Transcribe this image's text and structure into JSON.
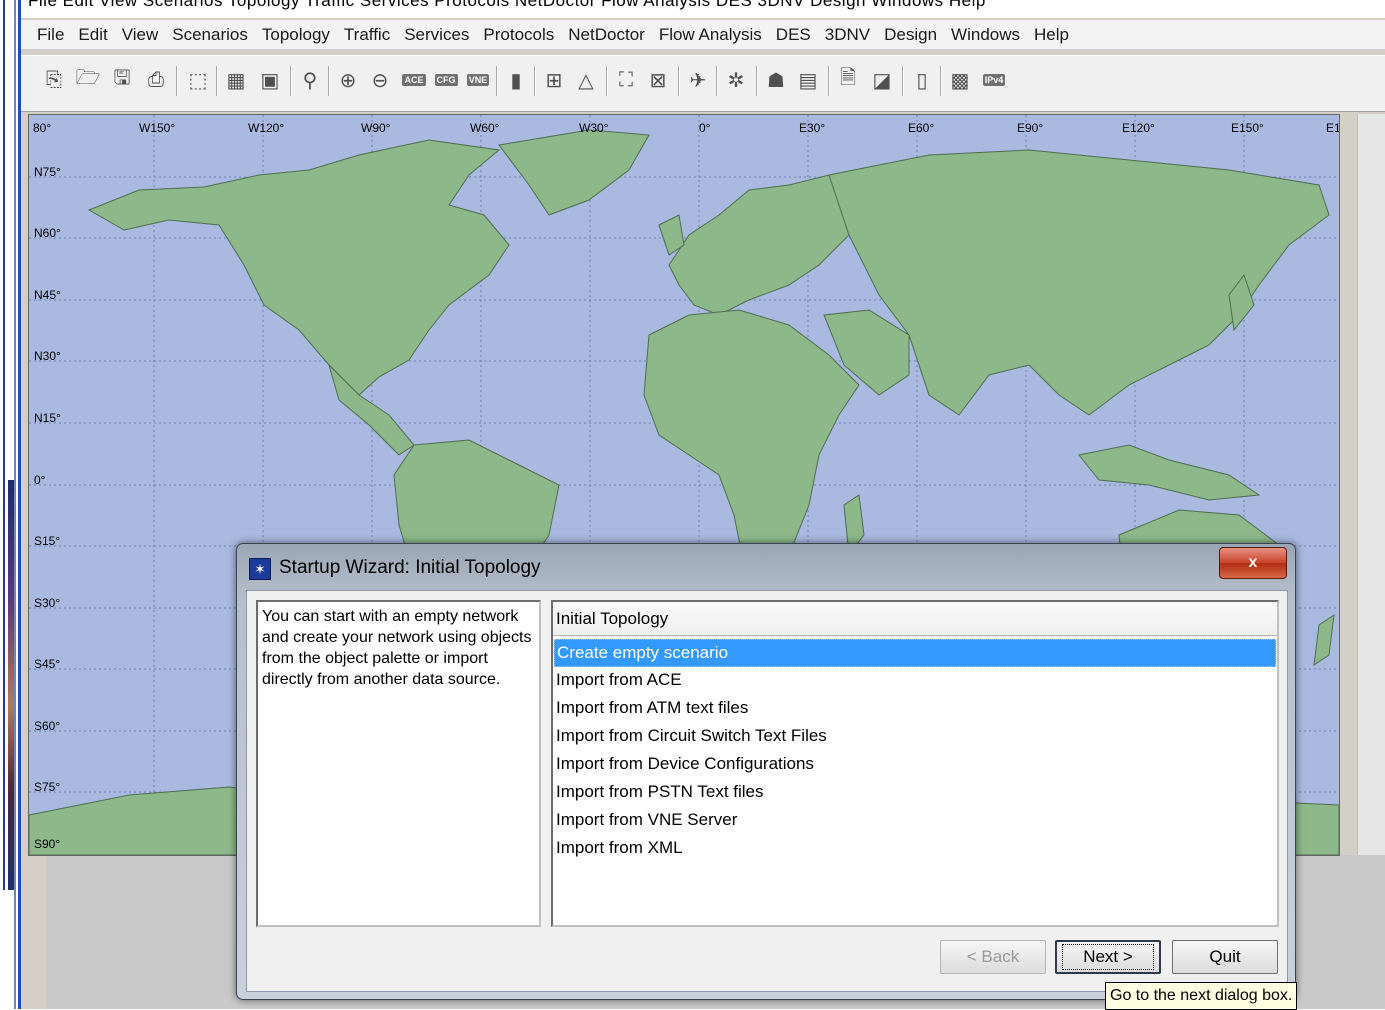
{
  "app": {
    "title_remnant": "File Edit View Scenarios Topology Traffic Services Protocols NetDoctor Flow Analysis DES 3DNV Design Windows Help"
  },
  "menu": [
    "File",
    "Edit",
    "View",
    "Scenarios",
    "Topology",
    "Traffic",
    "Services",
    "Protocols",
    "NetDoctor",
    "Flow Analysis",
    "DES",
    "3DNV",
    "Design",
    "Windows",
    "Help"
  ],
  "toolbar": {
    "badges": {
      "ace": "ACE",
      "cfg": "CFG",
      "vne": "VNE",
      "ipv": "IPv4"
    }
  },
  "map": {
    "lon_labels": [
      "80°",
      "W150°",
      "W120°",
      "W90°",
      "W60°",
      "W30°",
      "0°",
      "E30°",
      "E60°",
      "E90°",
      "E120°",
      "E150°",
      "E1"
    ],
    "lat_labels": [
      "N75°",
      "N60°",
      "N45°",
      "N30°",
      "N15°",
      "0°",
      "S15°",
      "S30°",
      "S45°",
      "S60°",
      "S75°",
      "S90°"
    ],
    "colors": {
      "ocean": "#a9b9e0",
      "land": "#8db88a",
      "border": "#4f6e50"
    }
  },
  "dialog": {
    "title": "Startup Wizard: Initial Topology",
    "close_label": "x",
    "description": "You can start with an empty network and create your network using objects from the object palette or import directly from another data source.",
    "list_header": "Initial Topology",
    "items": [
      "Create empty scenario",
      "Import from ACE",
      "Import from ATM text files",
      "Import from Circuit Switch Text Files",
      "Import from Device Configurations",
      "Import from PSTN Text files",
      "Import from VNE Server",
      "Import from XML"
    ],
    "selected_index": 0,
    "buttons": {
      "back": "< Back",
      "next": "Next >",
      "quit": "Quit"
    }
  },
  "tooltip": "Go to the next dialog box."
}
